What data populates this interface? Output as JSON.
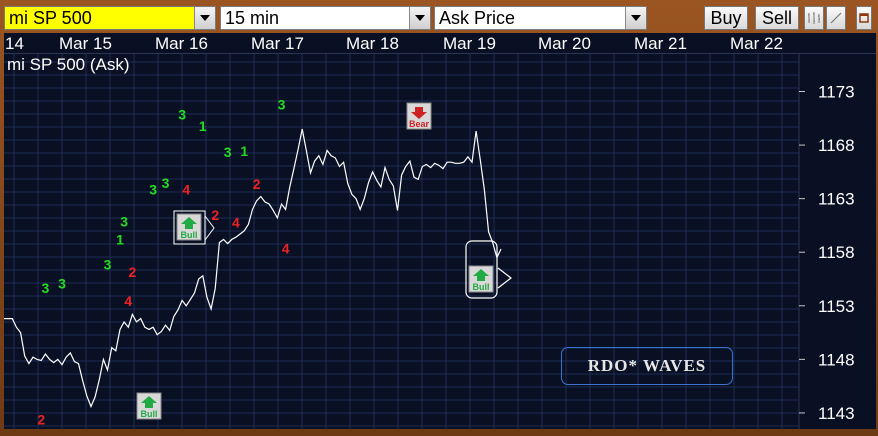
{
  "toolbar": {
    "instrument": "mi SP 500",
    "interval": "15 min",
    "price_type": "Ask Price",
    "buy_label": "Buy",
    "sell_label": "Sell",
    "instrument_bg": "#ffff00"
  },
  "dates": [
    "14",
    "Mar 15",
    "Mar 16",
    "Mar 17",
    "Mar 18",
    "Mar 19",
    "Mar 20",
    "Mar 21",
    "Mar 22"
  ],
  "chart_title": "mi SP 500 (Ask)",
  "branding": "RDO* WAVES",
  "chart_data": {
    "type": "line",
    "title": "mi SP 500 (Ask)",
    "xlabel": "",
    "ylabel": "",
    "y_ticks": [
      1173,
      1168,
      1163,
      1158,
      1153,
      1148,
      1143
    ],
    "ylim": [
      1141.5,
      1176.5
    ],
    "grid": true,
    "colors": {
      "line": "#ffffff",
      "grid": "#1c2d55",
      "up_label": "#22dd22",
      "down_label": "#ee2222",
      "bull": "#22aa44",
      "bear": "#cc2222"
    },
    "series": [
      {
        "values": [
          1151.8,
          1151.8,
          1151.8,
          1151.0,
          1150.5,
          1148.3,
          1147.6,
          1148.2,
          1148.0,
          1147.9,
          1148.5,
          1148.0,
          1147.7,
          1148.0,
          1147.5,
          1148.2,
          1148.6,
          1147.8,
          1147.6,
          1146.0,
          1144.6,
          1143.6,
          1144.5,
          1146.1,
          1148.0,
          1147.0,
          1149.1,
          1148.8,
          1150.8,
          1151.5,
          1151.0,
          1152.2,
          1151.5,
          1151.8,
          1151.0,
          1150.8,
          1151.0,
          1150.3,
          1150.6,
          1151.2,
          1150.7,
          1152.0,
          1152.6,
          1153.5,
          1153.0,
          1153.6,
          1154.2,
          1155.5,
          1155.8,
          1153.8,
          1152.7,
          1154.6,
          1158.9,
          1159.2,
          1158.8,
          1159.2,
          1159.4,
          1159.7,
          1160.0,
          1160.6,
          1162.0,
          1162.8,
          1163.2,
          1162.7,
          1162.5,
          1161.9,
          1161.2,
          1162.5,
          1162.0,
          1164.1,
          1165.8,
          1167.6,
          1169.5,
          1167.5,
          1165.4,
          1166.5,
          1167.0,
          1166.2,
          1167.5,
          1167.0,
          1166.8,
          1166.0,
          1166.4,
          1164.4,
          1163.4,
          1163.0,
          1162.0,
          1163.0,
          1164.5,
          1165.5,
          1164.7,
          1164.1,
          1165.9,
          1164.8,
          1164.2,
          1161.9,
          1165.2,
          1166.0,
          1166.5,
          1165.0,
          1164.8,
          1166.0,
          1166.2,
          1165.9,
          1166.3,
          1166.1,
          1165.8,
          1166.4,
          1166.4,
          1166.3,
          1166.3,
          1166.4,
          1166.9,
          1166.4,
          1169.3,
          1166.6,
          1163.8,
          1159.9,
          1158.9,
          1157.5,
          1158.3
        ]
      }
    ],
    "wave_labels": [
      {
        "text": "3",
        "kind": "up",
        "i": 10,
        "y": 1154.2
      },
      {
        "text": "3",
        "kind": "up",
        "i": 14,
        "y": 1154.6
      },
      {
        "text": "2",
        "kind": "down",
        "i": 9,
        "y": 1141.9
      },
      {
        "text": "3",
        "kind": "up",
        "i": 25,
        "y": 1156.4
      },
      {
        "text": "1",
        "kind": "up",
        "i": 28,
        "y": 1158.7
      },
      {
        "text": "3",
        "kind": "up",
        "i": 29,
        "y": 1160.4
      },
      {
        "text": "2",
        "kind": "down",
        "i": 31,
        "y": 1155.7
      },
      {
        "text": "4",
        "kind": "down",
        "i": 30,
        "y": 1153.0
      },
      {
        "text": "3",
        "kind": "up",
        "i": 36,
        "y": 1163.4
      },
      {
        "text": "3",
        "kind": "up",
        "i": 39,
        "y": 1164.0
      },
      {
        "text": "3",
        "kind": "up",
        "i": 43,
        "y": 1170.4
      },
      {
        "text": "4",
        "kind": "down",
        "i": 44,
        "y": 1163.4
      },
      {
        "text": "1",
        "kind": "up",
        "i": 48,
        "y": 1169.3
      },
      {
        "text": "2",
        "kind": "down",
        "i": 51,
        "y": 1161.0
      },
      {
        "text": "3",
        "kind": "up",
        "i": 54,
        "y": 1166.9
      },
      {
        "text": "4",
        "kind": "down",
        "i": 56,
        "y": 1160.3
      },
      {
        "text": "1",
        "kind": "up",
        "i": 58,
        "y": 1167.0
      },
      {
        "text": "2",
        "kind": "down",
        "i": 61,
        "y": 1163.9
      },
      {
        "text": "3",
        "kind": "up",
        "i": 67,
        "y": 1171.3
      },
      {
        "text": "4",
        "kind": "down",
        "i": 68,
        "y": 1157.9
      }
    ],
    "signals": [
      {
        "text": "Bull",
        "kind": "bull",
        "label_anchor": "1143"
      },
      {
        "text": "Bull",
        "kind": "bull",
        "label_anchor": "1160"
      },
      {
        "text": "Bear",
        "kind": "bear",
        "label_anchor": "1170"
      },
      {
        "text": "Bull",
        "kind": "bull",
        "label_anchor": "1155"
      }
    ]
  }
}
